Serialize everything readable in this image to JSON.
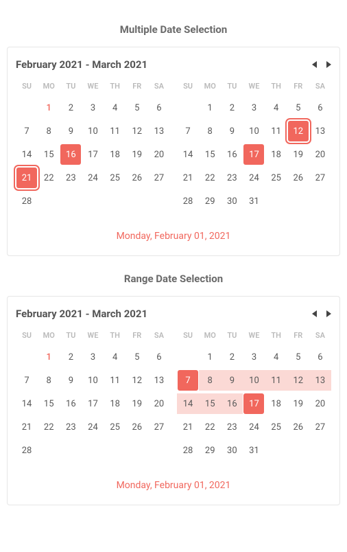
{
  "section1": {
    "title": "Multiple Date Selection",
    "header": "February 2021 - March 2021",
    "weekdays": [
      "SU",
      "MO",
      "TU",
      "WE",
      "TH",
      "FR",
      "SA"
    ],
    "month1": {
      "rows": [
        [
          null,
          {
            "d": "1",
            "today": true
          },
          {
            "d": "2"
          },
          {
            "d": "3"
          },
          {
            "d": "4"
          },
          {
            "d": "5"
          },
          {
            "d": "6"
          }
        ],
        [
          {
            "d": "7"
          },
          {
            "d": "8"
          },
          {
            "d": "9"
          },
          {
            "d": "10"
          },
          {
            "d": "11"
          },
          {
            "d": "12"
          },
          {
            "d": "13"
          }
        ],
        [
          {
            "d": "14"
          },
          {
            "d": "15"
          },
          {
            "d": "16",
            "selected": true
          },
          {
            "d": "17"
          },
          {
            "d": "18"
          },
          {
            "d": "19"
          },
          {
            "d": "20"
          }
        ],
        [
          {
            "d": "21",
            "focused": true
          },
          {
            "d": "22"
          },
          {
            "d": "23"
          },
          {
            "d": "24"
          },
          {
            "d": "25"
          },
          {
            "d": "26"
          },
          {
            "d": "27"
          }
        ],
        [
          {
            "d": "28"
          },
          null,
          null,
          null,
          null,
          null,
          null
        ]
      ]
    },
    "month2": {
      "rows": [
        [
          null,
          {
            "d": "1"
          },
          {
            "d": "2"
          },
          {
            "d": "3"
          },
          {
            "d": "4"
          },
          {
            "d": "5"
          },
          {
            "d": "6"
          }
        ],
        [
          {
            "d": "7"
          },
          {
            "d": "8"
          },
          {
            "d": "9"
          },
          {
            "d": "10"
          },
          {
            "d": "11"
          },
          {
            "d": "12",
            "focused": true
          },
          {
            "d": "13"
          }
        ],
        [
          {
            "d": "14"
          },
          {
            "d": "15"
          },
          {
            "d": "16"
          },
          {
            "d": "17",
            "selected": true
          },
          {
            "d": "18"
          },
          {
            "d": "19"
          },
          {
            "d": "20"
          }
        ],
        [
          {
            "d": "21"
          },
          {
            "d": "22"
          },
          {
            "d": "23"
          },
          {
            "d": "24"
          },
          {
            "d": "25"
          },
          {
            "d": "26"
          },
          {
            "d": "27"
          }
        ],
        [
          {
            "d": "28"
          },
          {
            "d": "29"
          },
          {
            "d": "30"
          },
          {
            "d": "31"
          },
          null,
          null,
          null
        ]
      ]
    },
    "footer": "Monday, February 01, 2021"
  },
  "section2": {
    "title": "Range Date Selection",
    "header": "February 2021 - March 2021",
    "weekdays": [
      "SU",
      "MO",
      "TU",
      "WE",
      "TH",
      "FR",
      "SA"
    ],
    "month1": {
      "rows": [
        [
          null,
          {
            "d": "1",
            "today": true
          },
          {
            "d": "2"
          },
          {
            "d": "3"
          },
          {
            "d": "4"
          },
          {
            "d": "5"
          },
          {
            "d": "6"
          }
        ],
        [
          {
            "d": "7"
          },
          {
            "d": "8"
          },
          {
            "d": "9"
          },
          {
            "d": "10"
          },
          {
            "d": "11"
          },
          {
            "d": "12"
          },
          {
            "d": "13"
          }
        ],
        [
          {
            "d": "14"
          },
          {
            "d": "15"
          },
          {
            "d": "16"
          },
          {
            "d": "17"
          },
          {
            "d": "18"
          },
          {
            "d": "19"
          },
          {
            "d": "20"
          }
        ],
        [
          {
            "d": "21"
          },
          {
            "d": "22"
          },
          {
            "d": "23"
          },
          {
            "d": "24"
          },
          {
            "d": "25"
          },
          {
            "d": "26"
          },
          {
            "d": "27"
          }
        ],
        [
          {
            "d": "28"
          },
          null,
          null,
          null,
          null,
          null,
          null
        ]
      ]
    },
    "month2": {
      "rows": [
        [
          null,
          {
            "d": "1"
          },
          {
            "d": "2"
          },
          {
            "d": "3"
          },
          {
            "d": "4"
          },
          {
            "d": "5"
          },
          {
            "d": "6"
          }
        ],
        [
          {
            "d": "7",
            "selected": true
          },
          {
            "d": "8",
            "range": true
          },
          {
            "d": "9",
            "range": true
          },
          {
            "d": "10",
            "range": true
          },
          {
            "d": "11",
            "range": true
          },
          {
            "d": "12",
            "range": true
          },
          {
            "d": "13",
            "range": true
          }
        ],
        [
          {
            "d": "14",
            "range": true
          },
          {
            "d": "15",
            "range": true
          },
          {
            "d": "16",
            "range": true
          },
          {
            "d": "17",
            "selected": true
          },
          {
            "d": "18"
          },
          {
            "d": "19"
          },
          {
            "d": "20"
          }
        ],
        [
          {
            "d": "21"
          },
          {
            "d": "22"
          },
          {
            "d": "23"
          },
          {
            "d": "24"
          },
          {
            "d": "25"
          },
          {
            "d": "26"
          },
          {
            "d": "27"
          }
        ],
        [
          {
            "d": "28"
          },
          {
            "d": "29"
          },
          {
            "d": "30"
          },
          {
            "d": "31"
          },
          null,
          null,
          null
        ]
      ]
    },
    "footer": "Monday, February 01, 2021"
  }
}
